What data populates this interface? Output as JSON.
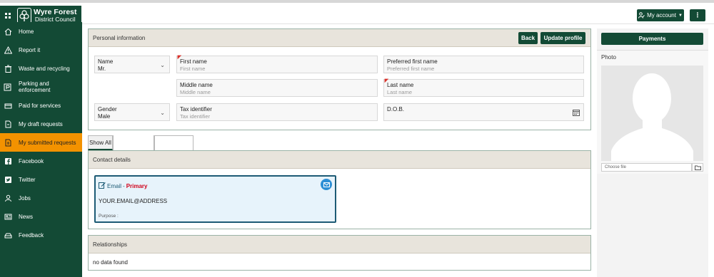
{
  "header": {
    "logo_line1": "Wyre Forest",
    "logo_line2": "District Council",
    "account_label": "My account",
    "more_label": "⋮"
  },
  "sidebar": {
    "items": [
      {
        "label": "Home",
        "icon": "home-icon"
      },
      {
        "label": "Report it",
        "icon": "warning-icon"
      },
      {
        "label": "Waste and recycling",
        "icon": "bin-icon"
      },
      {
        "label": "Parking and enforcement",
        "icon": "parking-icon"
      },
      {
        "label": "Paid for services",
        "icon": "payment-icon"
      },
      {
        "label": "My draft requests",
        "icon": "draft-icon"
      },
      {
        "label": "My submitted requests",
        "icon": "document-icon",
        "active": true
      },
      {
        "label": "Facebook",
        "icon": "facebook-icon"
      },
      {
        "label": "Twitter",
        "icon": "twitter-icon"
      },
      {
        "label": "Jobs",
        "icon": "person-icon"
      },
      {
        "label": "News",
        "icon": "news-icon"
      },
      {
        "label": "Feedback",
        "icon": "feedback-icon"
      }
    ]
  },
  "personal": {
    "title": "Personal information",
    "back_label": "Back",
    "update_label": "Update profile",
    "name_label": "Name",
    "name_value": "Mr.",
    "first_name_label": "First name",
    "first_name_placeholder": "First name",
    "preferred_label": "Preferred first name",
    "preferred_placeholder": "Preferred first name",
    "middle_label": "Middle name",
    "middle_placeholder": "Middle name",
    "last_label": "Last name",
    "last_placeholder": "Last name",
    "gender_label": "Gender",
    "gender_value": "Male",
    "tax_label": "Tax identifier",
    "tax_placeholder": "Tax identifier",
    "dob_label": "D.O.B."
  },
  "tabs": {
    "show_all": "Show All"
  },
  "contact": {
    "title": "Contact details",
    "email_label": "Email",
    "primary_label": "Primary",
    "email_value": "YOUR.EMAIL@ADDRESS",
    "purpose_label": "Purpose :"
  },
  "relationships": {
    "title": "Relationships",
    "empty": "no data found"
  },
  "right": {
    "payments_label": "Payments",
    "photo_label": "Photo",
    "choose_file": "Choose file"
  },
  "colors": {
    "brand_green": "#134a35",
    "active_orange": "#f39200",
    "required_red": "#d9322b",
    "primary_red": "#d0021b"
  }
}
